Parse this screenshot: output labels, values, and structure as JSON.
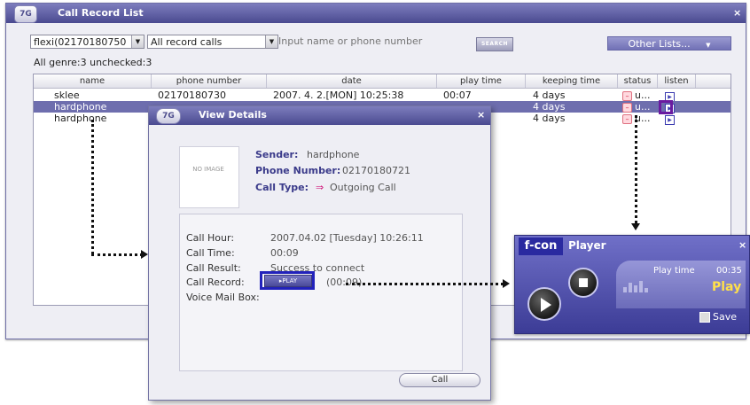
{
  "main_window": {
    "title": "Call Record List",
    "close_glyph": "×",
    "logo_text": "7G",
    "user_select": "flexi(02170180750",
    "calltype_select": "All record calls",
    "search_placeholder": "Input name or phone number",
    "search_button": "SEARCH",
    "other_lists": "Other Lists...",
    "summary": "All genre:3  unchecked:3"
  },
  "table": {
    "columns": [
      "name",
      "phone number",
      "date",
      "play time",
      "keeping time",
      "status",
      "listen"
    ],
    "rows": [
      {
        "name": "sklee",
        "phone": "02170180730",
        "date": "2007. 4. 2.[MON] 10:25:38",
        "play_time": "00:07",
        "keeping": "4 days",
        "status": "u...",
        "selected": false
      },
      {
        "name": "hardphone",
        "phone": "",
        "date": "",
        "play_time": "",
        "keeping": "4 days",
        "status": "u...",
        "selected": true
      },
      {
        "name": "hardphone",
        "phone": "",
        "date": "",
        "play_time": "",
        "keeping": "4 days",
        "status": "u...",
        "selected": false
      }
    ]
  },
  "details": {
    "title": "View Details",
    "close_glyph": "×",
    "no_image": "NO IMAGE",
    "sender_label": "Sender:",
    "sender_value": "hardphone",
    "phone_label": "Phone Number:",
    "phone_value": "02170180721",
    "calltype_label": "Call Type:",
    "calltype_value": "Outgoing Call",
    "call_hour_label": "Call Hour:",
    "call_hour_value": "2007.04.02 [Tuesday] 10:26:11",
    "call_time_label": "Call Time:",
    "call_time_value": "00:09",
    "call_result_label": "Call Result:",
    "call_result_value": "Success to connect",
    "call_record_label": "Call Record:",
    "play_button": "▸PLAY",
    "record_duration": "(00:09)",
    "voicemail_label": "Voice Mail Box:",
    "call_button": "Call"
  },
  "player": {
    "brand": "f-con",
    "label": "Player",
    "close_glyph": "×",
    "play_time_label": "Play time",
    "play_time_value": "00:35",
    "status": "Play",
    "save": "Save"
  },
  "colors": {
    "titlebar": "#5a5aa0",
    "selection": "#6e6eae",
    "highlight_purple": "#6a1aa0",
    "highlight_blue": "#2222bb",
    "player_accent": "#ffe04a"
  },
  "icons": [
    "app-logo-icon",
    "close-icon",
    "dropdown-arrow-icon",
    "status-unchecked-icon",
    "listen-play-icon",
    "no-image-icon",
    "arrow-right-icon",
    "play-icon",
    "stop-icon",
    "equalizer-icon",
    "save-icon"
  ]
}
